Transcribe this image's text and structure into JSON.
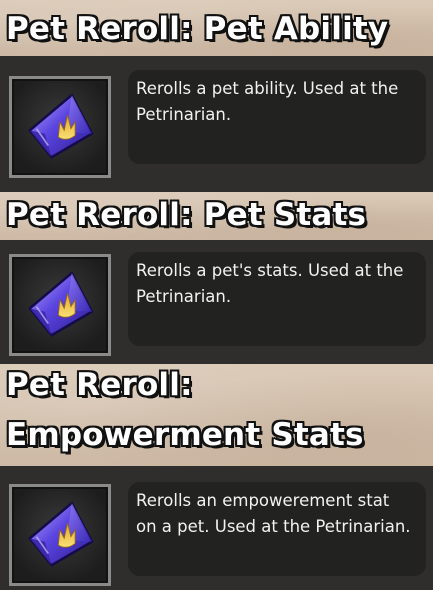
{
  "items": [
    {
      "title": "Pet Reroll: Pet Ability",
      "description": "Rerolls a pet ability. Used at the\nPetrinarian.",
      "icon": "crystal-shard-icon"
    },
    {
      "title": "Pet Reroll: Pet Stats",
      "description": "Rerolls a pet's stats. Used at the\nPetrinarian.",
      "icon": "crystal-shard-icon"
    },
    {
      "title_line1": "Pet Reroll:",
      "title_line2": "Empowerment Stats",
      "description": "Rerolls an empowerement stat\non a pet. Used at the Petrinarian.",
      "icon": "crystal-shard-icon"
    }
  ],
  "colors": {
    "banner": "#d3c0ad",
    "panel": "#2f2e2c",
    "description_box": "#222221",
    "crystal": "#5a3fd6",
    "flame": "#f2d04a"
  }
}
